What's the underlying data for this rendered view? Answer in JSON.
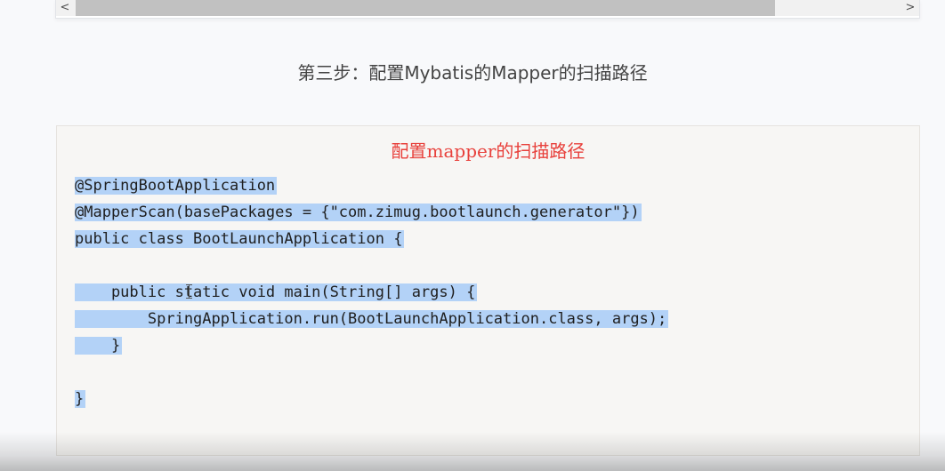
{
  "top_scroller": {
    "left_arrow": "<",
    "right_arrow": ">"
  },
  "step_heading": "第三步：配置Mybatis的Mapper的扫描路径",
  "code_block": {
    "title": "配置mapper的扫描路径",
    "title_color": "#e8413c",
    "selection_color": "#b3d2f7",
    "lines": [
      "@SpringBootApplication",
      "@MapperScan(basePackages = {\"com.zimug.bootlaunch.generator\"})",
      "public class BootLaunchApplication {",
      "",
      "    public static void main(String[] args) {",
      "        SpringApplication.run(BootLaunchApplication.class, args);",
      "    }",
      "",
      "}"
    ]
  }
}
